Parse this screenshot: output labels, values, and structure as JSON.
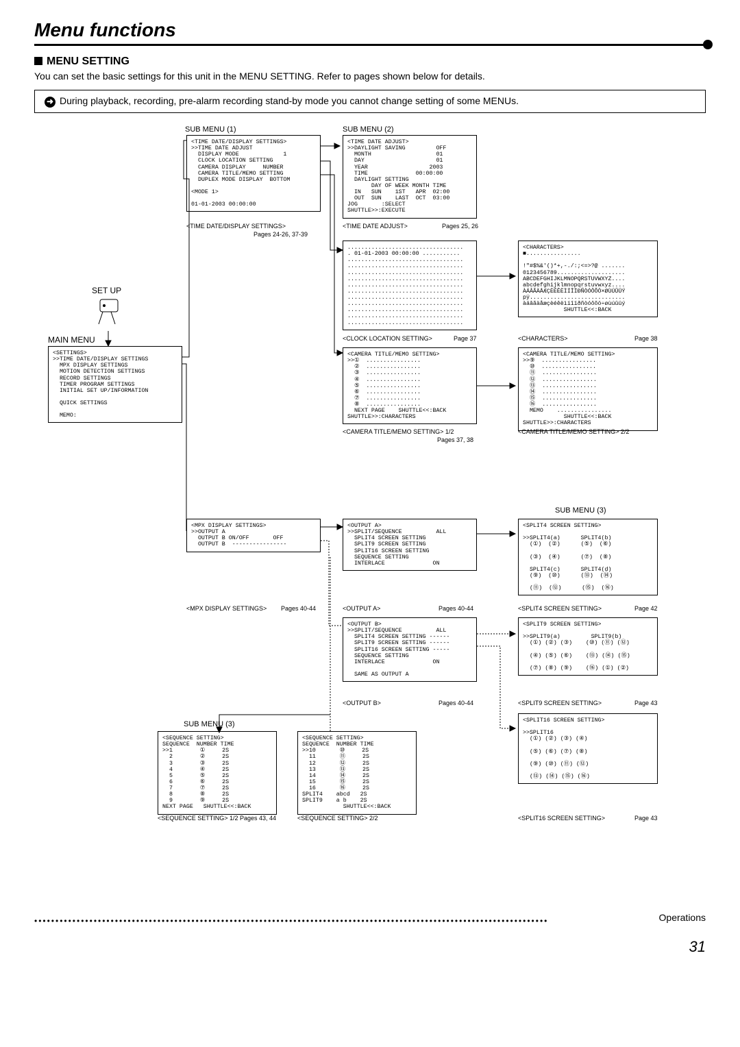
{
  "page": {
    "title": "Menu functions",
    "section": "MENU SETTING",
    "intro": "You can set the basic settings for this unit in the MENU SETTING.  Refer to pages shown below for details.",
    "note": "During playback, recording, pre-alarm recording stand-by mode you cannot change setting of some MENUs.",
    "footer": "Operations",
    "page_number": "31"
  },
  "labels": {
    "setup": "SET UP",
    "main_menu": "MAIN MENU",
    "submenu1": "SUB MENU (1)",
    "submenu2": "SUB MENU (2)",
    "submenu3_a": "SUB MENU (3)",
    "submenu3_b": "SUB MENU (3)"
  },
  "panels": {
    "main_menu_box": "<SETTINGS>\n>>TIME DATE/DISPLAY SETTINGS\n  MPX DISPLAY SETTINGS\n  MOTION DETECTION SETTINGS\n  RECORD SETTINGS\n  TIMER PROGRAM SETTINGS\n  INITIAL SET UP/INFORMATION\n\n  QUICK SETTINGS\n\n  MEMO:",
    "sm1_time_date": "<TIME DATE/DISPLAY SETTINGS>\n>>TIME DATE ADJUST\n  DISPLAY MODE             1\n  CLOCK LOCATION SETTING\n  CAMERA DISPLAY     NUMBER\n  CAMERA TITLE/MEMO SETTING\n  DUPLEX MODE DISPLAY  BOTTOM\n\n<MODE 1>\n\n01-01-2003 00:00:00",
    "sm2_time_adjust": "<TIME DATE ADJUST>\n>>DAYLIGHT SAVING         OFF\n  MONTH                   01\n  DAY                     01\n  YEAR                  2003\n  TIME              00:00:00\n  DAYLIGHT SETTING\n       DAY OF WEEK MONTH TIME\n  IN   SUN    1ST   APR  02:00\n  OUT  SUN    LAST  OCT  03:00\nJOG       :SELECT\nSHUTTLE>>:EXECUTE",
    "clock_loc": "..................................\n. 01-01-2003 00:00:00 ...........\n..................................\n..................................\n..................................\n..................................\n..................................\n..................................\n..................................\n..................................\n..................................\n..................................\n..................................",
    "characters": "<CHARACTERS>\n■................\n\n!\"#$%&'()*+,-./:;<=>?@ .......\n0123456789....................\nABCDEFGHIJKLMNOPQRSTUVWXYZ....\nabcdefghijklmnopqrstuvwxyz....\nÀÁÂÃÄÅÆÇÈÉÊËÌÍÎÏÐÑÒÓÔÕÖ×ØÙÚÛÜÝ\npÿ............................\nàáâãäåæçèéêëìíîïðñòóôõö÷øùúûüý\n            SHUTTLE<<:BACK",
    "cam_title_1": "<CAMERA TITLE/MEMO SETTING>\n>>①  ................\n  ②  ................\n  ③  ................\n  ④  ................\n  ⑤  ................\n  ⑥  ................\n  ⑦  ................\n  ⑧  ................\n  NEXT PAGE    SHUTTLE<<:BACK\nSHUTTLE>>:CHARACTERS",
    "cam_title_2": "<CAMERA TITLE/MEMO SETTING>\n>>⑨  ................\n  ⑩  ................\n  ⑪  ................\n  ⑫  ................\n  ⑬  ................\n  ⑭  ................\n  ⑮  ................\n  ⑯  ................\n  MEMO    ................\n            SHUTTLE<<:BACK\nSHUTTLE>>:CHARACTERS",
    "mpx": "<MPX DISPLAY SETTINGS>\n>>OUTPUT A\n  OUTPUT B ON/OFF       OFF\n  OUTPUT B  ----------------",
    "output_a": "<OUTPUT A>\n>>SPLIT/SEQUENCE          ALL\n  SPLIT4 SCREEN SETTING\n  SPLIT9 SCREEN SETTING\n  SPLIT16 SCREEN SETTING\n  SEQUENCE SETTING\n  INTERLACE              ON",
    "output_b": "<OUTPUT B>\n>>SPLIT/SEQUENCE          ALL\n  SPLIT4 SCREEN SETTING ------\n  SPLIT9 SCREEN SETTING ------\n  SPLIT16 SCREEN SETTING -----\n  SEQUENCE SETTING\n  INTERLACE              ON\n\n  SAME AS OUTPUT A",
    "split4": "<SPLIT4 SCREEN SETTING>\n\n>>SPLIT4(a)      SPLIT4(b)\n  (①)  (②)      (⑤)  (⑥)\n\n  (③)  (④)      (⑦)  (⑧)\n\n  SPLIT4(c)      SPLIT4(d)\n  (⑨)  (⑩)      (⑬)  (⑭)\n\n  (⑪)  (⑫)      (⑮)  (⑯)",
    "split9": "<SPLIT9 SCREEN SETTING>\n\n>>SPLIT9(a)         SPLIT9(b)\n  (①) (②) (③)    (⑩) (⑪) (⑫)\n\n  (④) (⑤) (⑥)    (⑬) (⑭) (⑮)\n\n  (⑦) (⑧) (⑨)    (⑯) (①) (②)",
    "split16": "<SPLIT16 SCREEN SETTING>\n\n>>SPLIT16\n  (①) (②) (③) (④)\n\n  (⑤) (⑥) (⑦) (⑧)\n\n  (⑨) (⑩) (⑪) (⑫)\n\n  (⑬) (⑭) (⑮) (⑯)",
    "seq1": "<SEQUENCE SETTING>\nSEQUENCE  NUMBER TIME\n>>1        ①     2S\n  2        ②     2S\n  3        ③     2S\n  4        ④     2S\n  5        ⑤     2S\n  6        ⑥     2S\n  7        ⑦     2S\n  8        ⑧     2S\n  9        ⑨     2S\nNEXT PAGE   SHUTTLE<<:BACK",
    "seq2": "<SEQUENCE SETTING>\nSEQUENCE  NUMBER TIME\n>>10       ⑩     2S\n  11       ⑪     2S\n  12       ⑫     2S\n  13       ⑬     2S\n  14       ⑭     2S\n  15       ⑮     2S\n  16       ⑯     2S\nSPLIT4    abcd   2S\nSPLIT9    a b    2S\n            SHUTTLE<<:BACK"
  },
  "captions": {
    "c1": "<TIME DATE/DISPLAY SETTINGS>",
    "c1p": "Pages 24-26, 37-39",
    "c2": "<TIME DATE ADJUST>",
    "c2p": "Pages 25, 26",
    "c3": "<CLOCK LOCATION SETTING>",
    "c3p": "Page 37",
    "c4": "<CHARACTERS>",
    "c4p": "Page 38",
    "c5": "<CAMERA TITLE/MEMO SETTING> 1/2",
    "c5p": "Pages 37, 38",
    "c6": "<CAMERA TITLE/MEMO SETTING> 2/2",
    "c7": "<MPX DISPLAY SETTINGS>",
    "c7p": "Pages 40-44",
    "c8": "<OUTPUT A>",
    "c8p": "Pages 40-44",
    "c9": "<OUTPUT B>",
    "c9p": "Pages 40-44",
    "c10": "<SPLIT4 SCREEN SETTING>",
    "c10p": "Page 42",
    "c11": "<SPLIT9 SCREEN SETTING>",
    "c11p": "Page 43",
    "c12": "<SPLIT16 SCREEN SETTING>",
    "c12p": "Page 43",
    "c13": "<SEQUENCE SETTING> 1/2",
    "c13p": "Pages 43, 44",
    "c14": "<SEQUENCE SETTING> 2/2"
  }
}
